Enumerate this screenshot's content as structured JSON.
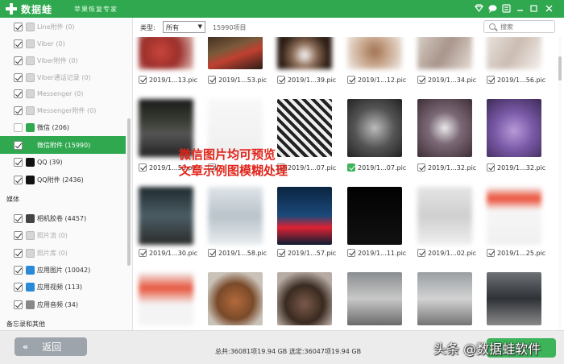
{
  "app": {
    "name": "数据蛙",
    "slogan": "苹果恢复专家"
  },
  "sidebar": {
    "items": [
      {
        "label": "Line附件 (0)",
        "checked": true,
        "enabled": false,
        "icon": "line-icon"
      },
      {
        "label": "Viber (0)",
        "checked": true,
        "enabled": false,
        "icon": "viber-icon"
      },
      {
        "label": "Viber附件 (0)",
        "checked": true,
        "enabled": false,
        "icon": "viber-icon"
      },
      {
        "label": "Viber通话记录 (0)",
        "checked": true,
        "enabled": false,
        "icon": "viber-icon"
      },
      {
        "label": "Messenger (0)",
        "checked": true,
        "enabled": false,
        "icon": "messenger-icon"
      },
      {
        "label": "Messenger附件 (0)",
        "checked": true,
        "enabled": false,
        "icon": "messenger-icon"
      },
      {
        "label": "微信 (206)",
        "checked": false,
        "enabled": true,
        "icon": "wechat-icon"
      },
      {
        "label": "微信附件 (15990)",
        "checked": true,
        "enabled": true,
        "active": true,
        "icon": "wechat-icon"
      },
      {
        "label": "QQ (39)",
        "checked": true,
        "enabled": true,
        "icon": "qq-icon"
      },
      {
        "label": "QQ附件 (2436)",
        "checked": true,
        "enabled": true,
        "icon": "qq-icon"
      }
    ],
    "media_section": "媒体",
    "media_items": [
      {
        "label": "相机胶卷 (4457)",
        "checked": true,
        "enabled": true,
        "icon": "camera-icon"
      },
      {
        "label": "照片流 (0)",
        "checked": true,
        "enabled": false,
        "icon": "photo-stream-icon"
      },
      {
        "label": "照片库 (0)",
        "checked": true,
        "enabled": false,
        "icon": "photo-library-icon"
      },
      {
        "label": "应用图片 (10042)",
        "checked": true,
        "enabled": true,
        "icon": "app-photos-icon"
      },
      {
        "label": "应用视频 (113)",
        "checked": true,
        "enabled": true,
        "icon": "app-videos-icon"
      },
      {
        "label": "应用音频 (34)",
        "checked": true,
        "enabled": true,
        "icon": "app-audio-icon"
      }
    ],
    "memo_section": "备忘录和其他"
  },
  "toolbar": {
    "type_label": "类型:",
    "type_value": "所有",
    "count": "15990项目",
    "search_placeholder": "搜索"
  },
  "files": [
    {
      "name": "2019/1...13.pic",
      "checked": true
    },
    {
      "name": "2019/1...53.pic",
      "checked": true
    },
    {
      "name": "2019/1...39.pic",
      "checked": true
    },
    {
      "name": "2019/1...12.pic",
      "checked": true
    },
    {
      "name": "2019/1...34.pic",
      "checked": true
    },
    {
      "name": "2019/1...56.pic",
      "checked": true
    },
    {
      "name": "2019/1...53.pic",
      "checked": true
    },
    {
      "name": "",
      "checked": true
    },
    {
      "name": "2019/1...07.pic",
      "checked": true
    },
    {
      "name": "2019/1...07.pic",
      "checked": true
    },
    {
      "name": "2019/1...32.pic",
      "checked": true
    },
    {
      "name": "2019/1...32.pic",
      "checked": true
    },
    {
      "name": "2019/1...30.pic",
      "checked": true
    },
    {
      "name": "2019/1...58.pic",
      "checked": true
    },
    {
      "name": "2019/1...57.pic",
      "checked": true
    },
    {
      "name": "2019/1...11.pic",
      "checked": true
    },
    {
      "name": "2019/1...02.pic",
      "checked": true
    },
    {
      "name": "2019/1...25.pic",
      "checked": true
    }
  ],
  "overlay": {
    "line1": "微信图片均可预览",
    "line2": "文章示例图模糊处理"
  },
  "bottom": {
    "back_label": "返回",
    "totals": "总共:36081项19.94 GB 选定:36047项19.94 GB",
    "watermark": "头条 @数据蛙软件"
  },
  "colors": {
    "brand_green": "#2fa84f",
    "overlay_red": "#e1261c"
  }
}
